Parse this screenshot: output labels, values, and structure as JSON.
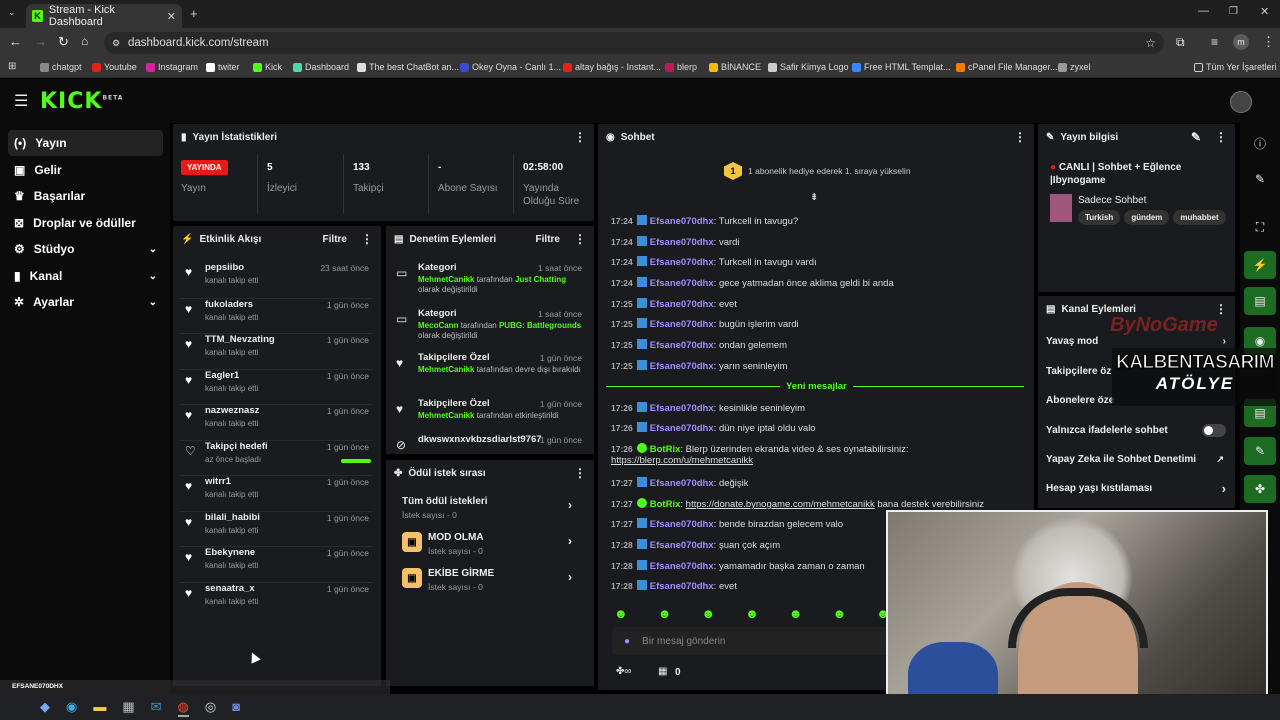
{
  "browser": {
    "tab_title": "Stream - Kick Dashboard",
    "url": "dashboard.kick.com/stream",
    "profile_initial": "m",
    "bookmarks": [
      "chatgpt",
      "Youtube",
      "Instagram",
      "twiter",
      "Kick",
      "Dashboard",
      "The best ChatBot an...",
      "Okey Oyna - Canlı 1...",
      "altay bağış - Instant...",
      "blerp",
      "BİNANCE",
      "Safir Kimya Logo",
      "Free HTML Templat...",
      "cPanel File Manager...",
      "zyxel"
    ],
    "bookmarks_folder": "Tüm Yer İşaretleri"
  },
  "sidebar": {
    "items": [
      "Yayın",
      "Gelir",
      "Başarılar",
      "Droplar ve ödüller",
      "Stüdyo",
      "Kanal",
      "Ayarlar"
    ]
  },
  "stats": {
    "title": "Yayın İstatistikleri",
    "live_badge": "YAYINDA",
    "live_label": "Yayın",
    "viewers": "5",
    "viewers_label": "İzleyici",
    "followers": "133",
    "followers_label": "Takipçi",
    "subs": "-",
    "subs_label": "Abone Sayısı",
    "duration": "02:58:00",
    "duration_label": "Yayında Olduğu Süre"
  },
  "activity": {
    "title": "Etkinlik Akışı",
    "filter": "Filtre",
    "items": [
      {
        "name": "pepsiibo",
        "sub": "kanalı takip etti",
        "time": "23 saat önce"
      },
      {
        "name": "fukoladers",
        "sub": "kanalı takip etti",
        "time": "1 gün önce"
      },
      {
        "name": "TTM_Nevzating",
        "sub": "kanalı takip etti",
        "time": "1 gün önce"
      },
      {
        "name": "Eagler1",
        "sub": "kanalı takip etti",
        "time": "1 gün önce"
      },
      {
        "name": "nazweznasz",
        "sub": "kanalı takip etti",
        "time": "1 gün önce"
      },
      {
        "name": "Takipçi hedefi",
        "sub": "az önce başladı",
        "time": "1 gün önce"
      },
      {
        "name": "witrr1",
        "sub": "kanalı takip etti",
        "time": "1 gün önce"
      },
      {
        "name": "bilali_habibi",
        "sub": "kanalı takip etti",
        "time": "1 gün önce"
      },
      {
        "name": "Ebekynene",
        "sub": "kanalı takip etti",
        "time": "1 gün önce"
      },
      {
        "name": "senaatra_x",
        "sub": "kanalı takip etti",
        "time": "1 gün önce"
      }
    ]
  },
  "modlog": {
    "title": "Denetim Eylemleri",
    "filter": "Filtre",
    "items": [
      {
        "name": "Kategori",
        "user": "MehmetCanikk",
        "mid": "tarafından",
        "val": "Just Chatting",
        "tail": "olarak değiştirildi",
        "time": "1 saat önce"
      },
      {
        "name": "Kategori",
        "user": "MecoCann",
        "mid": "tarafından",
        "val": "PUBG: Battlegrounds",
        "tail": "olarak değiştirildi",
        "time": "1 saat önce"
      },
      {
        "name": "Takipçilere Özel",
        "user": "MehmetCanikk",
        "mid": "tarafından devre dışı bırakıldı",
        "val": "",
        "tail": "",
        "time": "1 gün önce"
      },
      {
        "name": "Takipçilere Özel",
        "user": "MehmetCanikk",
        "mid": "tarafından etkinleştirildi",
        "val": "",
        "tail": "",
        "time": "1 gün önce"
      },
      {
        "name": "dkwswxnxvkbzsdiarlst9767",
        "user": "",
        "mid": "",
        "val": "",
        "tail": "",
        "time": "1 gün önce"
      }
    ]
  },
  "rewards": {
    "title": "Ödül istek sırası",
    "all": "Tüm ödül istekleri",
    "all_count": "İstek sayısı - 0",
    "items": [
      {
        "name": "MOD OLMA",
        "count": "İstek sayısı - 0"
      },
      {
        "name": "EKİBE GİRME",
        "count": "İstek sayısı - 0"
      }
    ]
  },
  "chat": {
    "title": "Sohbet",
    "banner": "1 abonelik hediye ederek 1. sıraya yükselin",
    "banner_num": "1",
    "new_label": "Yeni mesajlar",
    "placeholder": "Bir mesaj gönderin",
    "count": "0",
    "messages": [
      {
        "t": "17:24",
        "u": "Efsane070dhx",
        "m": "Turkcell in tavugu?"
      },
      {
        "t": "17:24",
        "u": "Efsane070dhx",
        "m": "vardi"
      },
      {
        "t": "17:24",
        "u": "Efsane070dhx",
        "m": "Turkcell in tavugu vardı"
      },
      {
        "t": "17:24",
        "u": "Efsane070dhx",
        "m": "gece yatmadan önce aklima geldi bi anda"
      },
      {
        "t": "17:25",
        "u": "Efsane070dhx",
        "m": "evet"
      },
      {
        "t": "17:25",
        "u": "Efsane070dhx",
        "m": "bugün işlerim vardi"
      },
      {
        "t": "17:25",
        "u": "Efsane070dhx",
        "m": "ondan gelemem"
      },
      {
        "t": "17:25",
        "u": "Efsane070dhx",
        "m": "yarın seninleyim"
      },
      {
        "t": "17:26",
        "u": "Efsane070dhx",
        "m": "kesinlikle seninleyim"
      },
      {
        "t": "17:26",
        "u": "Efsane070dhx",
        "m": "dün niye iptal oldu valo"
      },
      {
        "t": "17:26",
        "u": "BotRix",
        "m": "Blerp üzerinden ekranda video & ses oynatabilirsiniz:",
        "m2": "https://blerp.com/u/mehmetcanikk"
      },
      {
        "t": "17:27",
        "u": "Efsane070dhx",
        "m": "değişik"
      },
      {
        "t": "17:27",
        "u": "BotRix",
        "m": "https://donate.bynogame.com/mehmetcanikk",
        "m2b": "bana destek verebilirsiniz"
      },
      {
        "t": "17:27",
        "u": "Efsane070dhx",
        "m": "bende birazdan gelecem valo"
      },
      {
        "t": "17:28",
        "u": "Efsane070dhx",
        "m": "şuan çok açım"
      },
      {
        "t": "17:28",
        "u": "Efsane070dhx",
        "m": "yamamadır başka zaman o zaman"
      },
      {
        "t": "17:28",
        "u": "Efsane070dhx",
        "m": "evet"
      }
    ]
  },
  "streaminfo": {
    "title": "Yayın bilgisi",
    "stream_title": "CANLI | Sohbet + Eğlence |Ibynogame",
    "category": "Sadece Sohbet",
    "tags": [
      "Turkish",
      "gündem",
      "muhabbet"
    ]
  },
  "channel_actions": {
    "title": "Kanal Eylemleri",
    "items": [
      "Yavaş mod",
      "Takipçilere öz",
      "Abonelere öze",
      "Yalnızca ifadelerle sohbet",
      "Yapay Zeka ile Sohbet Denetimi",
      "Hesap yaşı kıstılaması"
    ]
  },
  "overlay": {
    "brand1": "ByNoGame",
    "brand2": "KALBENTASARIM",
    "brand3": "ATÖLYE",
    "notif_user": "EFSANE070DHX",
    "notif_msg": "evet"
  },
  "colors": {
    "accent": "#53fc18",
    "live": "#e91916",
    "username": "#a48bff"
  }
}
